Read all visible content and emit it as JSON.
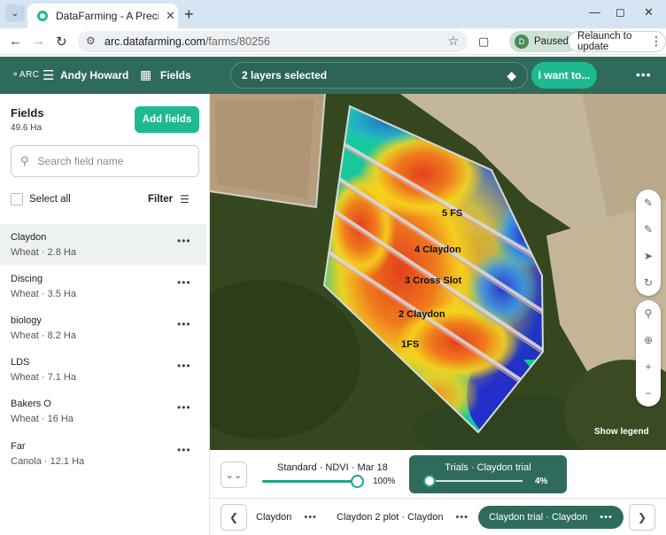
{
  "browser": {
    "tab_title": "DataFarming - A Precision Agric",
    "url_host": "arc.datafarming.com",
    "url_path": "/farms/80256",
    "profile_initial": "D",
    "profile_status": "Paused",
    "relaunch_label": "Relaunch to update"
  },
  "header": {
    "logo": "ARC",
    "user_name": "Andy Howard",
    "fields_nav": "Fields",
    "layers_label": "2 layers selected",
    "i_want_to": "I want to..."
  },
  "sidebar": {
    "title": "Fields",
    "total_area": "49.6 Ha",
    "add_fields_label": "Add fields",
    "search_placeholder": "Search field name",
    "select_all_label": "Select all",
    "filter_label": "Filter",
    "fields": [
      {
        "name": "Claydon",
        "detail": "Wheat · 2.8 Ha",
        "selected": true
      },
      {
        "name": "Discing",
        "detail": "Wheat · 3.5 Ha",
        "selected": false
      },
      {
        "name": "biology",
        "detail": "Wheat · 8.2 Ha",
        "selected": false
      },
      {
        "name": "LDS",
        "detail": "Wheat · 7.1 Ha",
        "selected": false
      },
      {
        "name": "Bakers O",
        "detail": "Wheat · 16 Ha",
        "selected": false
      },
      {
        "name": "Far",
        "detail": "Canola · 12.1 Ha",
        "selected": false
      }
    ]
  },
  "map": {
    "plot_labels": [
      "5 FS",
      "4 Claydon",
      "3 Cross Slot",
      "2 Claydon",
      "1FS"
    ],
    "show_legend": "Show legend",
    "tool_icons": [
      "pencil-icon",
      "ruler-icon",
      "pin-icon",
      "redo-icon",
      "zoom-search-icon",
      "locate-icon",
      "zoom-in-icon",
      "zoom-out-icon"
    ]
  },
  "layers_panel": {
    "standard_label": "Standard · NDVI · Mar 18",
    "standard_opacity": "100%",
    "standard_opacity_value": 1.0,
    "trials_label": "Trials · Claydon trial",
    "trials_opacity": "4%",
    "trials_opacity_value": 0.04
  },
  "trials_strip": {
    "items": [
      {
        "label": "Claydon",
        "active": false
      },
      {
        "label": "Claydon 2 plot · Claydon",
        "active": false
      },
      {
        "label": "Claydon trial · Claydon",
        "active": true
      }
    ]
  },
  "colors": {
    "brand_dark": "#2f6b5d",
    "accent": "#1fb98f"
  }
}
